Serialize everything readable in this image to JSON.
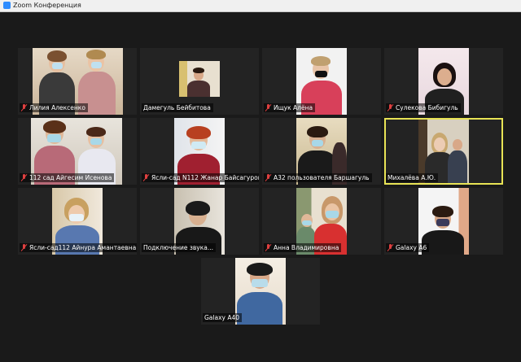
{
  "window": {
    "title": "Zoom Конференция"
  },
  "participants": [
    {
      "name": "Лилия Алексенко",
      "muted": true
    },
    {
      "name": "Дамегуль Бейбитова",
      "muted": false
    },
    {
      "name": "Ищук Алёна",
      "muted": true
    },
    {
      "name": "Сулекова Бибигуль",
      "muted": true
    },
    {
      "name": "112 сад Айгесим Исенова",
      "muted": true
    },
    {
      "name": "Ясли-сад N112 Жанар Байсагурова",
      "muted": true
    },
    {
      "name": "А32 пользователя Баршагуль",
      "muted": true
    },
    {
      "name": "Михалёва А.Ю.",
      "muted": false,
      "active_speaker": true
    },
    {
      "name": "Ясли-сад112 Айнура Амантаевна",
      "muted": true
    },
    {
      "name": "Подключение звука...",
      "muted": false
    },
    {
      "name": "Анна Владимировна",
      "muted": true
    },
    {
      "name": "Galaxy A6",
      "muted": true
    },
    {
      "name": "Galaxy A40",
      "muted": false
    }
  ],
  "colors": {
    "stage": "#1a1a1a",
    "tile": "#232323",
    "active_border": "#e8e355",
    "mute": "#e04040"
  }
}
